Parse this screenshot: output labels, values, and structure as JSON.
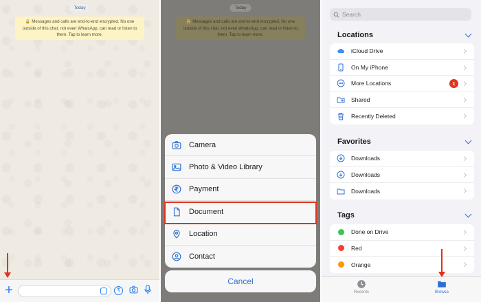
{
  "chat": {
    "date": "Today",
    "encryption_note": "Messages and calls are end-to-end encrypted. No one outside of this chat, not even WhatsApp, can read or listen to them. Tap to learn more.",
    "plus_icon": "plus-icon",
    "rupee_icon": "rupee-icon",
    "camera_icon": "camera-icon",
    "mic_icon": "mic-icon"
  },
  "sheet": {
    "items": [
      {
        "label": "Camera",
        "icon": "camera-icon"
      },
      {
        "label": "Photo & Video Library",
        "icon": "photo-icon"
      },
      {
        "label": "Payment",
        "icon": "rupee-icon"
      },
      {
        "label": "Document",
        "icon": "document-icon"
      },
      {
        "label": "Location",
        "icon": "location-icon"
      },
      {
        "label": "Contact",
        "icon": "contact-icon"
      }
    ],
    "cancel": "Cancel"
  },
  "files": {
    "search_placeholder": "Search",
    "locations": {
      "title": "Locations",
      "items": [
        {
          "label": "iCloud Drive",
          "icon": "icloud-icon"
        },
        {
          "label": "On My iPhone",
          "icon": "iphone-icon"
        },
        {
          "label": "More Locations",
          "icon": "more-icon",
          "badge": "1"
        },
        {
          "label": "Shared",
          "icon": "shared-folder-icon"
        },
        {
          "label": "Recently Deleted",
          "icon": "trash-icon"
        }
      ]
    },
    "favorites": {
      "title": "Favorites",
      "items": [
        {
          "label": "Downloads",
          "icon": "download-icon"
        },
        {
          "label": "Downloads",
          "icon": "download-icon"
        },
        {
          "label": "Downloads",
          "icon": "folder-icon"
        }
      ]
    },
    "tags": {
      "title": "Tags",
      "items": [
        {
          "label": "Done on Drive",
          "color": "#34c759"
        },
        {
          "label": "Red",
          "color": "#ff3b30"
        },
        {
          "label": "Orange",
          "color": "#ff9500"
        }
      ]
    },
    "tabs": {
      "recents": "Recents",
      "browse": "Browse"
    }
  },
  "colors": {
    "accent": "#2f6fd6",
    "highlight": "#e0341c",
    "badge": "#e0341c"
  }
}
